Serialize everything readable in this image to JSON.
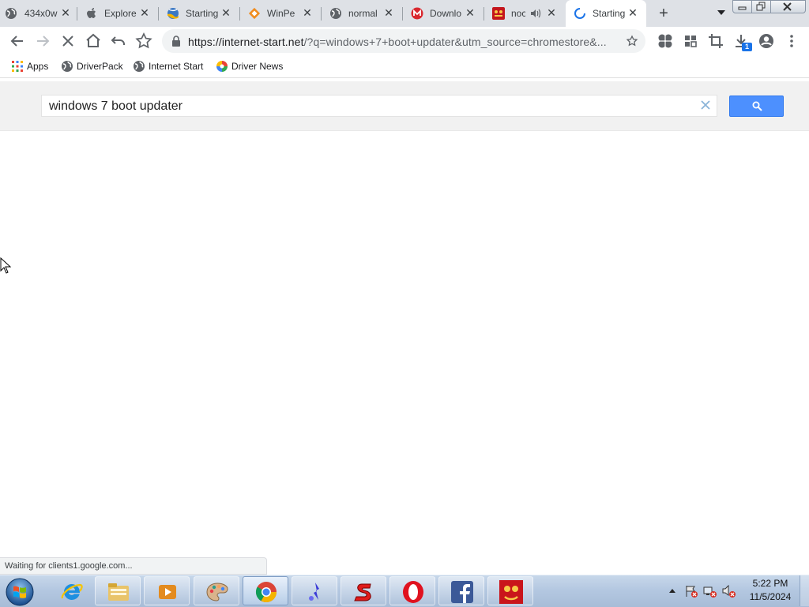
{
  "tabs": [
    {
      "label": "434x0w",
      "icon": "globe-icon",
      "active": false
    },
    {
      "label": "Explore",
      "icon": "apple-icon",
      "active": false
    },
    {
      "label": "Starting",
      "icon": "internet-start-icon",
      "active": false
    },
    {
      "label": "WinPe",
      "icon": "winpe-icon",
      "active": false
    },
    {
      "label": "normal",
      "icon": "globe-icon",
      "active": false
    },
    {
      "label": "Downlo",
      "icon": "mega-icon",
      "active": false
    },
    {
      "label": "noc",
      "icon": "red-app-icon",
      "active": false,
      "audio": true
    },
    {
      "label": "Starting",
      "icon": "loading-spinner-icon",
      "active": true
    }
  ],
  "toolbar": {
    "url_host": "https://internet-start.net",
    "url_rest": "/?q=windows+7+boot+updater&utm_source=chromestore&...",
    "download_badge": "1"
  },
  "bookmarks": [
    {
      "label": "Apps",
      "icon": "apps-grid-icon"
    },
    {
      "label": "DriverPack",
      "icon": "globe-icon"
    },
    {
      "label": "Internet Start",
      "icon": "globe-icon"
    },
    {
      "label": "Driver News",
      "icon": "driver-news-icon"
    }
  ],
  "search": {
    "query": "windows 7 boot updater"
  },
  "status_text": "Waiting for clients1.google.com...",
  "taskbar": {
    "apps": [
      "internet-explorer",
      "file-explorer",
      "media-player",
      "paint",
      "chrome",
      "network-tool",
      "red-s-app",
      "opera",
      "facebook",
      "red-game-app"
    ],
    "clock_time": "5:22 PM",
    "clock_date": "11/5/2024"
  },
  "colors": {
    "search_button": "#4d90fe",
    "tab_strip": "#dee1e6",
    "taskbar": "#b4c8e1"
  }
}
